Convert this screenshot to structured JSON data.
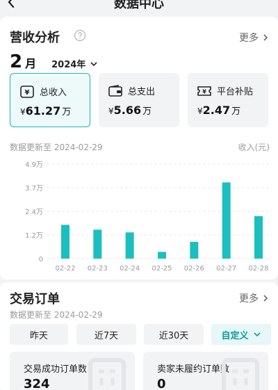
{
  "header": {
    "title": "数据中心"
  },
  "revenue": {
    "title": "营收分析",
    "more": "更多",
    "month": "2",
    "month_unit": "月",
    "year": "2024年",
    "stats": [
      {
        "label": "总收入",
        "currency": "¥",
        "value": "61.27",
        "unit": "万"
      },
      {
        "label": "总支出",
        "currency": "¥",
        "value": "5.66",
        "unit": "万"
      },
      {
        "label": "平台补贴",
        "currency": "¥",
        "value": "2.47",
        "unit": "万"
      }
    ],
    "updated": "数据更新至 2024-02-29",
    "unit_label": "收入(元)"
  },
  "chart_data": {
    "type": "bar",
    "categories": [
      "02-22",
      "02-23",
      "02-24",
      "02-25",
      "02-26",
      "02-27",
      "02-28"
    ],
    "values": [
      1.75,
      1.5,
      1.36,
      0.35,
      0.87,
      3.95,
      2.2
    ],
    "y_ticks": [
      "0",
      "1.2万",
      "2.4万",
      "3.7万",
      "4.9万"
    ],
    "y_tick_values": [
      0,
      1.225,
      2.45,
      3.675,
      4.9
    ],
    "ylim": [
      0,
      4.9
    ],
    "ylabel": "收入(元)",
    "grid": true,
    "color": "#1cbfbf"
  },
  "orders": {
    "title": "交易订单",
    "more": "更多",
    "updated": "数据更新至 2024-02-29",
    "ranges": [
      "昨天",
      "近7天",
      "近30天",
      "自定义"
    ],
    "cards": [
      {
        "label": "交易成功订单数",
        "value": "324"
      },
      {
        "label": "卖家未履约订单数",
        "value": "0"
      }
    ]
  },
  "colors": {
    "accent": "#1cb5b5",
    "bar": "#1cbfbf",
    "muted": "#9a9a9a"
  }
}
